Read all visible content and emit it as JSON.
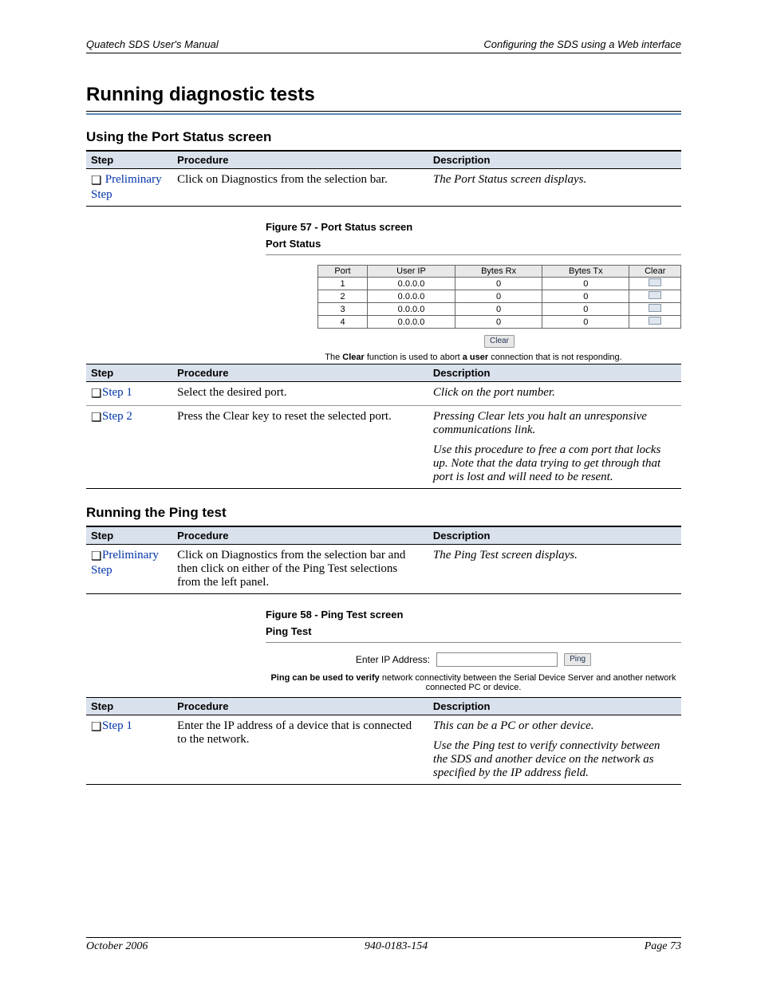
{
  "header": {
    "left": "Quatech SDS User's Manual",
    "right": "Configuring the SDS using a Web interface"
  },
  "section_title": "Running diagnostic tests",
  "port_status": {
    "subtitle": "Using the Port Status screen",
    "th_step": "Step",
    "th_proc": "Procedure",
    "th_desc": "Description",
    "row_prelim": {
      "bullet": "❑",
      "step": "Preliminary Step",
      "proc": "Click on Diagnostics from the selection bar.",
      "desc": "The Port Status screen displays."
    },
    "fig_caption": "Figure 57 - Port Status screen",
    "screen_title": "Port Status",
    "table": {
      "cols": [
        "Port",
        "User IP",
        "Bytes Rx",
        "Bytes Tx",
        "Clear"
      ],
      "rows": [
        [
          "1",
          "0.0.0.0",
          "0",
          "0"
        ],
        [
          "2",
          "0.0.0.0",
          "0",
          "0"
        ],
        [
          "3",
          "0.0.0.0",
          "0",
          "0"
        ],
        [
          "4",
          "0.0.0.0",
          "0",
          "0"
        ]
      ]
    },
    "clear_btn": "Clear",
    "note_prefix": "The ",
    "note_bold1": "Clear",
    "note_mid1": " function is",
    "note_mid2": " used to abort ",
    "note_bold2": "a user",
    "note_suffix": " connection that is not responding.",
    "row1": {
      "bullet": "❑",
      "step": "Step 1",
      "proc": "Select the desired port.",
      "desc": "Click on the port number."
    },
    "row2": {
      "bullet": "❑",
      "step": "Step 2",
      "proc": "Press the Clear key to reset the selected port.",
      "desc1": "Pressing Clear lets you halt an unresponsive communications link.",
      "desc2": "Use this procedure to free a com port that locks up. Note that the data trying to get through that port is lost and will need to be resent."
    }
  },
  "ping": {
    "subtitle": "Running the Ping test",
    "th_step": "Step",
    "th_proc": "Procedure",
    "th_desc": "Description",
    "row_prelim": {
      "bullet": "❑",
      "step": "Preliminary Step",
      "proc": "Click on Diagnostics from the selection bar and then click on either of the Ping Test selections from the left panel.",
      "desc": "The Ping Test screen displays."
    },
    "fig_caption": "Figure 58 - Ping Test screen",
    "screen_title": "Ping Test",
    "ip_label": "Enter IP Address:",
    "ping_btn": "Ping",
    "note_prefix": "Ping can be used to verify",
    "note_rest": " network connectivity between the Serial Device Server and another network connected PC or device.",
    "row1": {
      "bullet": "❑",
      "step": "Step 1",
      "proc": "Enter the IP address of a device that is connected to the network.",
      "desc1": "This can be a PC or other device.",
      "desc2": "Use the Ping test to verify connectivity between the SDS and another device on the network as specified by the IP address field."
    }
  },
  "footer": {
    "left": "October 2006",
    "center": "940-0183-154",
    "right": "Page 73"
  }
}
